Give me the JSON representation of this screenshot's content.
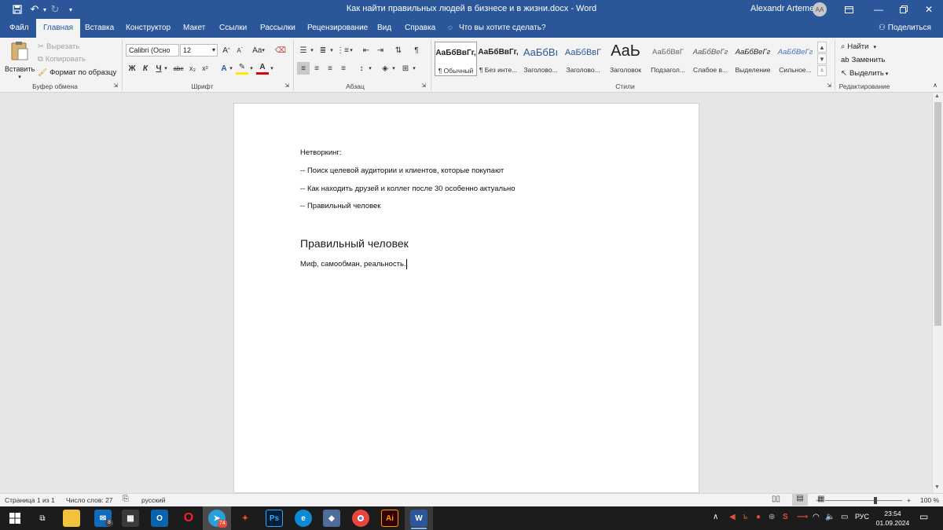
{
  "window": {
    "title": "Как найти правильных людей в бизнесе и в жизни.docx  -  Word",
    "user_name": "Alexandr Artemev",
    "user_initials": "AA"
  },
  "quick_access": {
    "save_icon": "save-icon",
    "undo_icon": "undo-icon",
    "redo_icon": "redo-icon",
    "customize_icon": "customize-qat-icon"
  },
  "tabs": [
    {
      "label": "Файл"
    },
    {
      "label": "Главная"
    },
    {
      "label": "Вставка"
    },
    {
      "label": "Конструктор"
    },
    {
      "label": "Макет"
    },
    {
      "label": "Ссылки"
    },
    {
      "label": "Рассылки"
    },
    {
      "label": "Рецензирование"
    },
    {
      "label": "Вид"
    },
    {
      "label": "Справка"
    }
  ],
  "active_tab": "Главная",
  "tellme": {
    "placeholder": "Что вы хотите сделать?"
  },
  "share": {
    "label": "Поделиться"
  },
  "ribbon": {
    "clipboard": {
      "label": "Буфер обмена",
      "paste": "Вставить",
      "cut": "Вырезать",
      "copy": "Копировать",
      "format_painter": "Формат по образцу"
    },
    "font": {
      "label": "Шрифт",
      "font_name": "Calibri (Осно",
      "font_size": "12",
      "change_case": "Aa",
      "bold": "Ж",
      "italic": "К",
      "underline": "Ч",
      "strike": "abc",
      "subscript": "x₂",
      "superscript": "x²"
    },
    "paragraph": {
      "label": "Абзац"
    },
    "styles": {
      "label": "Стили",
      "items": [
        {
          "sample": "АаБбВвГг,",
          "name": "¶ Обычный"
        },
        {
          "sample": "АаБбВвГг,",
          "name": "¶ Без инте..."
        },
        {
          "sample": "АаБбВı",
          "name": "Заголово..."
        },
        {
          "sample": "АаБбВвГ",
          "name": "Заголово..."
        },
        {
          "sample": "АаЬ",
          "name": "Заголовок"
        },
        {
          "sample": "АаБбВвГ",
          "name": "Подзагол..."
        },
        {
          "sample": "АаБбВеГг",
          "name": "Слабое в..."
        },
        {
          "sample": "АаБбВеГг",
          "name": "Выделение"
        },
        {
          "sample": "АаБбВеГг",
          "name": "Сильное..."
        }
      ]
    },
    "editing": {
      "label": "Редактирование",
      "find": "Найти",
      "replace": "Заменить",
      "select": "Выделить"
    }
  },
  "document": {
    "lines": [
      "Нетворкинг:",
      "-- Поиск целевой аудитории и клиентов, которые покупают",
      "-- Как находить друзей и коллег после 30 особенно актуально",
      "-- Правильный человек"
    ],
    "heading": "Правильный человек",
    "body": "Миф, самообман, реальность."
  },
  "status": {
    "page": "Страница 1 из 1",
    "words": "Число слов: 27",
    "language": "русский",
    "zoom": "100 %",
    "zoom_minus": "−",
    "zoom_plus": "+"
  },
  "taskbar": {
    "language": "РУС",
    "time": "23:54",
    "date": "01.09.2024",
    "mail_badge": "8",
    "telegram_badge": "74"
  },
  "colors": {
    "word_blue": "#2b579a",
    "ribbon_bg": "#f3f3f3",
    "workspace_bg": "#e6e6e6",
    "taskbar_bg": "#1c1c1c"
  }
}
